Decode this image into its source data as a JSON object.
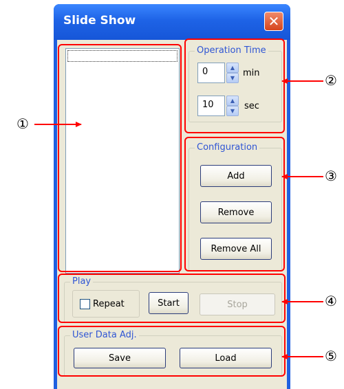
{
  "window": {
    "title": "Slide Show",
    "close_glyph": "✕"
  },
  "operation_time": {
    "label": "Operation Time",
    "minutes": {
      "value": "0",
      "unit": "min"
    },
    "seconds": {
      "value": "10",
      "unit": "sec"
    }
  },
  "configuration": {
    "label": "Configuration",
    "add": "Add",
    "remove": "Remove",
    "remove_all": "Remove All"
  },
  "play": {
    "label": "Play",
    "repeat": "Repeat",
    "repeat_checked": false,
    "start": "Start",
    "stop": "Stop"
  },
  "user_data": {
    "label": "User Data Adj.",
    "save": "Save",
    "load": "Load"
  },
  "callouts": {
    "c1": "①",
    "c2": "②",
    "c3": "③",
    "c4": "④",
    "c5": "⑤"
  },
  "colors": {
    "titlebar": "#1e63e6",
    "callout_red": "#ff0000",
    "group_label": "#2f55d4"
  }
}
